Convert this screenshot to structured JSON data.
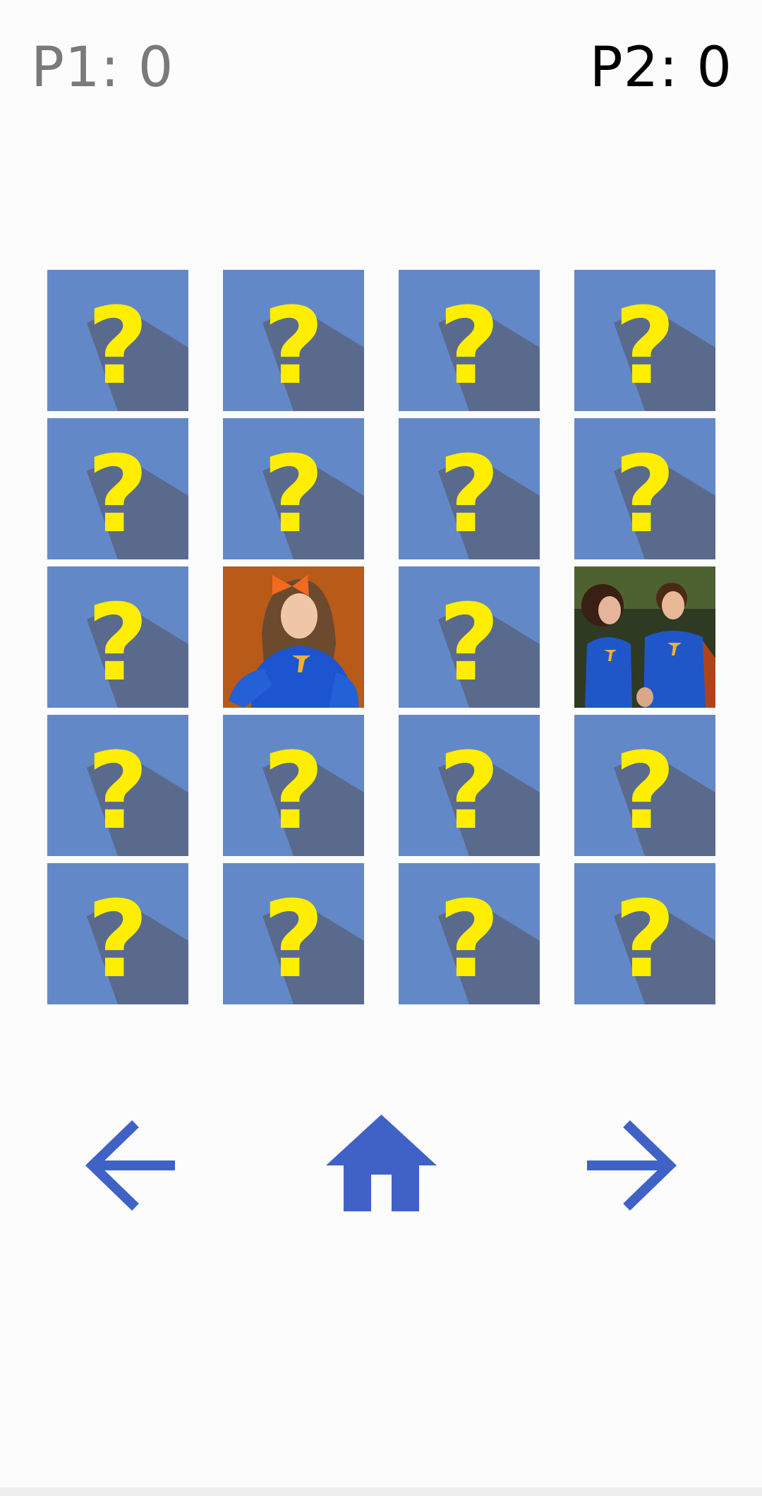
{
  "scores": {
    "p1_label": "P1: 0",
    "p2_label": "P2: 0",
    "p1_value": 0,
    "p2_value": 0,
    "inactive_color": "#7a7a7a",
    "active_color": "#000000"
  },
  "board": {
    "rows": 5,
    "columns": 4,
    "card_back": {
      "glyph": "?",
      "background_color": "#6388c7",
      "shadow_color": "#5a6a8d",
      "glyph_color": "#ffee00"
    },
    "cards": [
      {
        "state": "hidden"
      },
      {
        "state": "hidden"
      },
      {
        "state": "hidden"
      },
      {
        "state": "hidden"
      },
      {
        "state": "hidden"
      },
      {
        "state": "hidden"
      },
      {
        "state": "hidden"
      },
      {
        "state": "hidden"
      },
      {
        "state": "hidden"
      },
      {
        "state": "revealed",
        "image": "photo-girl-superhero-suit"
      },
      {
        "state": "hidden"
      },
      {
        "state": "revealed",
        "image": "photo-superhero-family"
      },
      {
        "state": "hidden"
      },
      {
        "state": "hidden"
      },
      {
        "state": "hidden"
      },
      {
        "state": "hidden"
      },
      {
        "state": "hidden"
      },
      {
        "state": "hidden"
      },
      {
        "state": "hidden"
      },
      {
        "state": "hidden"
      }
    ]
  },
  "nav": {
    "back_icon": "arrow-left-icon",
    "home_icon": "home-icon",
    "next_icon": "arrow-right-icon",
    "color": "#4062c7"
  }
}
